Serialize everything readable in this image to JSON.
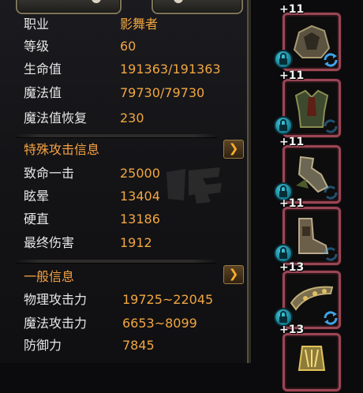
{
  "tabs": [
    {
      "label": ""
    },
    {
      "label": ""
    }
  ],
  "basic_stats": [
    {
      "label": "职业",
      "value": "影舞者"
    },
    {
      "label": "等级",
      "value": "60"
    },
    {
      "label": "生命值",
      "value": "191363/191363"
    },
    {
      "label": "魔法值",
      "value": "79730/79730"
    },
    {
      "label": "魔法值恢复",
      "value": "230"
    }
  ],
  "special_attack": {
    "title": "特殊攻击信息",
    "stats": [
      {
        "label": "致命一击",
        "value": "25000"
      },
      {
        "label": "眩晕",
        "value": "13404"
      },
      {
        "label": "硬直",
        "value": "13186"
      },
      {
        "label": "最终伤害",
        "value": "1912"
      }
    ]
  },
  "general_info": {
    "title": "一般信息",
    "stats": [
      {
        "label": "物理攻击力",
        "value": "19725~22045"
      },
      {
        "label": "魔法攻击力",
        "value": "6653~8099"
      },
      {
        "label": "防御力",
        "value": "7845"
      }
    ]
  },
  "equipment_slots": [
    {
      "enhance": "+11",
      "icon": "pauldron-icon"
    },
    {
      "enhance": "+11",
      "icon": "chest-armor-icon"
    },
    {
      "enhance": "+11",
      "icon": "gauntlet-icon"
    },
    {
      "enhance": "+11",
      "icon": "boots-icon"
    },
    {
      "enhance": "+13",
      "icon": "belt-icon"
    },
    {
      "enhance": "+13",
      "icon": "bracer-icon"
    }
  ],
  "colors": {
    "label": "#e6e6e6",
    "value": "#f2a640",
    "section_title": "#f5a142",
    "slot_frame": "#9a4654",
    "lock_badge": "#2aa7c0"
  }
}
